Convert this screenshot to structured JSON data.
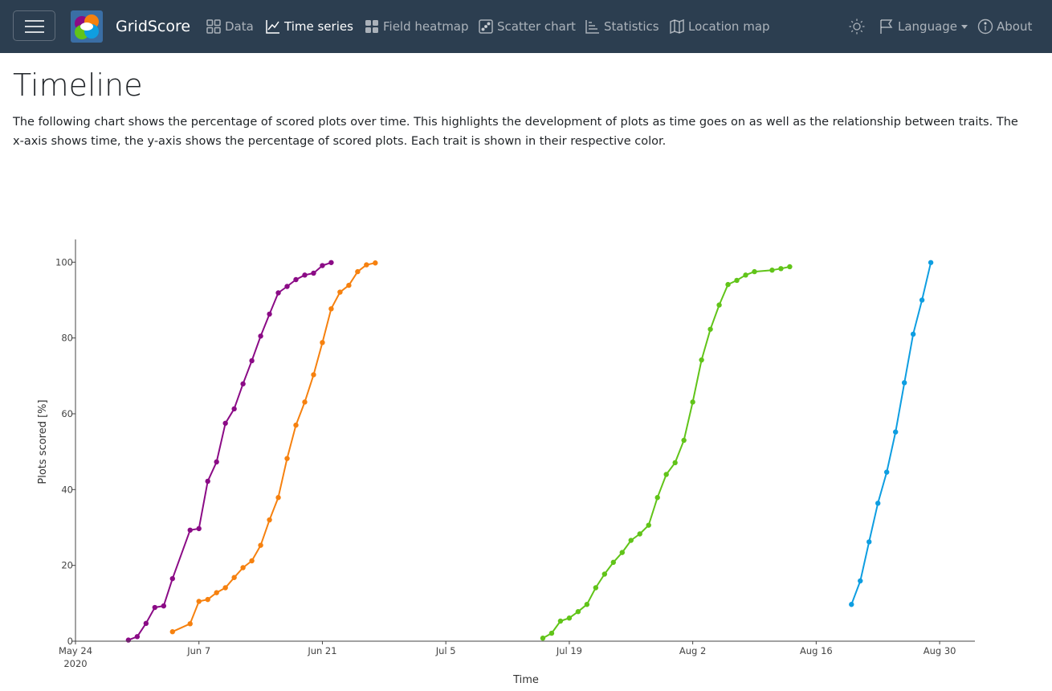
{
  "navbar": {
    "brand": "GridScore",
    "items": [
      {
        "label": "Data",
        "icon": "data-grid-icon"
      },
      {
        "label": "Time series",
        "icon": "line-chart-icon",
        "active": true
      },
      {
        "label": "Field heatmap",
        "icon": "grid-icon"
      },
      {
        "label": "Scatter chart",
        "icon": "dice-icon"
      },
      {
        "label": "Statistics",
        "icon": "statistics-icon"
      },
      {
        "label": "Location map",
        "icon": "map-icon"
      }
    ],
    "theme_icon": "sun-icon",
    "language": "Language",
    "about": "About"
  },
  "page": {
    "title": "Timeline",
    "description": "The following chart shows the percentage of scored plots over time. This highlights the development of plots as time goes on as well as the relationship between traits. The x-axis shows time, the y-axis shows the percentage of scored plots. Each trait is shown in their respective color."
  },
  "colors": {
    "navbar_bg": "#2c3e50",
    "purple": "#8b0b86",
    "orange": "#f6810f",
    "green": "#61c419",
    "blue": "#0e9ee1"
  },
  "chart_data": {
    "type": "line",
    "xlabel": "Time",
    "ylabel": "Plots scored [%]",
    "xlim": [
      "2020-05-24",
      "2020-09-03"
    ],
    "ylim": [
      0,
      106
    ],
    "x_ticks": [
      {
        "date": "2020-05-24",
        "label": "May 24",
        "sublabel": "2020"
      },
      {
        "date": "2020-06-07",
        "label": "Jun 7"
      },
      {
        "date": "2020-06-21",
        "label": "Jun 21"
      },
      {
        "date": "2020-07-05",
        "label": "Jul 5"
      },
      {
        "date": "2020-07-19",
        "label": "Jul 19"
      },
      {
        "date": "2020-08-02",
        "label": "Aug 2"
      },
      {
        "date": "2020-08-16",
        "label": "Aug 16"
      },
      {
        "date": "2020-08-30",
        "label": "Aug 30"
      }
    ],
    "y_ticks": [
      0,
      20,
      40,
      60,
      80,
      100
    ],
    "grid": false,
    "series": [
      {
        "color": "#8b0b86",
        "points": [
          [
            "2020-05-30",
            0.3
          ],
          [
            "2020-05-31",
            1.2
          ],
          [
            "2020-06-01",
            4.7
          ],
          [
            "2020-06-02",
            8.9
          ],
          [
            "2020-06-03",
            9.3
          ],
          [
            "2020-06-04",
            16.5
          ],
          [
            "2020-06-06",
            29.3
          ],
          [
            "2020-06-07",
            29.7
          ],
          [
            "2020-06-08",
            42.2
          ],
          [
            "2020-06-09",
            47.3
          ],
          [
            "2020-06-10",
            57.5
          ],
          [
            "2020-06-11",
            61.3
          ],
          [
            "2020-06-12",
            67.9
          ],
          [
            "2020-06-13",
            74.0
          ],
          [
            "2020-06-14",
            80.5
          ],
          [
            "2020-06-15",
            86.3
          ],
          [
            "2020-06-16",
            91.9
          ],
          [
            "2020-06-17",
            93.6
          ],
          [
            "2020-06-18",
            95.4
          ],
          [
            "2020-06-19",
            96.6
          ],
          [
            "2020-06-20",
            97.1
          ],
          [
            "2020-06-21",
            99.1
          ],
          [
            "2020-06-22",
            99.9
          ]
        ]
      },
      {
        "color": "#f6810f",
        "points": [
          [
            "2020-06-04",
            2.5
          ],
          [
            "2020-06-06",
            4.6
          ],
          [
            "2020-06-07",
            10.5
          ],
          [
            "2020-06-08",
            11.0
          ],
          [
            "2020-06-09",
            12.8
          ],
          [
            "2020-06-10",
            14.1
          ],
          [
            "2020-06-11",
            16.8
          ],
          [
            "2020-06-12",
            19.4
          ],
          [
            "2020-06-13",
            21.2
          ],
          [
            "2020-06-14",
            25.3
          ],
          [
            "2020-06-15",
            32.0
          ],
          [
            "2020-06-16",
            37.9
          ],
          [
            "2020-06-17",
            48.2
          ],
          [
            "2020-06-18",
            57.0
          ],
          [
            "2020-06-19",
            63.1
          ],
          [
            "2020-06-20",
            70.3
          ],
          [
            "2020-06-21",
            78.8
          ],
          [
            "2020-06-22",
            87.7
          ],
          [
            "2020-06-23",
            92.1
          ],
          [
            "2020-06-24",
            93.9
          ],
          [
            "2020-06-25",
            97.5
          ],
          [
            "2020-06-26",
            99.3
          ],
          [
            "2020-06-27",
            99.8
          ]
        ]
      },
      {
        "color": "#61c419",
        "points": [
          [
            "2020-07-16",
            0.8
          ],
          [
            "2020-07-17",
            2.1
          ],
          [
            "2020-07-18",
            5.3
          ],
          [
            "2020-07-19",
            6.1
          ],
          [
            "2020-07-20",
            7.8
          ],
          [
            "2020-07-21",
            9.7
          ],
          [
            "2020-07-22",
            14.1
          ],
          [
            "2020-07-23",
            17.7
          ],
          [
            "2020-07-24",
            20.8
          ],
          [
            "2020-07-25",
            23.4
          ],
          [
            "2020-07-26",
            26.6
          ],
          [
            "2020-07-27",
            28.3
          ],
          [
            "2020-07-28",
            30.6
          ],
          [
            "2020-07-29",
            37.9
          ],
          [
            "2020-07-30",
            44.0
          ],
          [
            "2020-07-31",
            47.1
          ],
          [
            "2020-08-01",
            53.0
          ],
          [
            "2020-08-02",
            63.1
          ],
          [
            "2020-08-03",
            74.2
          ],
          [
            "2020-08-04",
            82.3
          ],
          [
            "2020-08-05",
            88.7
          ],
          [
            "2020-08-06",
            94.1
          ],
          [
            "2020-08-07",
            95.2
          ],
          [
            "2020-08-08",
            96.6
          ],
          [
            "2020-08-09",
            97.5
          ],
          [
            "2020-08-11",
            97.9
          ],
          [
            "2020-08-12",
            98.3
          ],
          [
            "2020-08-13",
            98.8
          ]
        ]
      },
      {
        "color": "#0e9ee1",
        "points": [
          [
            "2020-08-20",
            9.7
          ],
          [
            "2020-08-21",
            15.9
          ],
          [
            "2020-08-22",
            26.2
          ],
          [
            "2020-08-23",
            36.4
          ],
          [
            "2020-08-24",
            44.6
          ],
          [
            "2020-08-25",
            55.2
          ],
          [
            "2020-08-26",
            68.2
          ],
          [
            "2020-08-27",
            81.0
          ],
          [
            "2020-08-28",
            90.0
          ],
          [
            "2020-08-29",
            99.9
          ]
        ]
      }
    ]
  }
}
